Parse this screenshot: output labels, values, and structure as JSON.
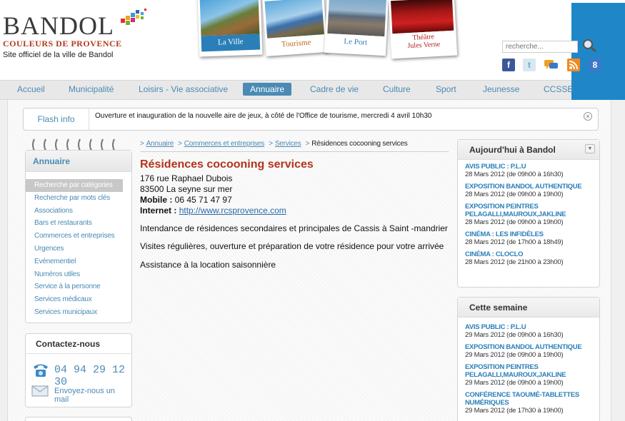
{
  "header": {
    "logo_title": "BANDOL",
    "logo_subtitle": "COULEURS DE PROVENCE",
    "site_name": "Site officiel de la ville de Bandol",
    "photos": [
      "La Ville",
      "Tourisme",
      "Le Port",
      "Théâtre\nJules Verne"
    ],
    "search_placeholder": "recherche...",
    "social": [
      "f",
      "t",
      "",
      "",
      "8"
    ]
  },
  "nav": {
    "items": [
      "Accueil",
      "Municipalité",
      "Loisirs - Vie associative",
      "Annuaire",
      "Cadre de vie",
      "Culture",
      "Sport",
      "Jeunesse",
      "CCSSB"
    ],
    "active": "Annuaire"
  },
  "flash": {
    "label": "Flash info",
    "text": "Ouverture et inauguration de la nouvelle aire de jeux, à côté de l'Office de tourisme, mercredi 4 avril 10h30",
    "close": "×"
  },
  "sidebar": {
    "title": "Annuaire",
    "items": [
      "Recherche par catégories",
      "Recherche par mots clés",
      "Associations",
      "Bars et restaurants",
      "Commerces et entreprises",
      "Urgences",
      "Evénementiel",
      "Numéros utiles",
      "Service à la personne",
      "Services médicaux",
      "Services municipaux"
    ],
    "active_index": 0
  },
  "contact": {
    "title": "Contactez-nous",
    "phone": "04 94 29 12 30",
    "mail_label": "Envoyez-nous un mail"
  },
  "breadcrumb": {
    "items": [
      "Annuaire",
      "Commerces et entreprises",
      "Services"
    ],
    "current": "Résidences cocooning services",
    "separator": ">"
  },
  "main": {
    "title": "Résidences cocooning services",
    "address_line1": "176 rue Raphael Dubois",
    "address_line2": "83500 La seyne sur mer",
    "mobile_label": "Mobile :",
    "mobile_value": " 06 45 71 47 97",
    "internet_label": "Internet :",
    "internet_value": "http://www.rcsprovence.com",
    "paragraphs": [
      "Intendance de résidences secondaires et principales de Cassis à Saint -mandrier",
      "Visites régulières, ouverture et préparation de votre résidence pour votre arrivée",
      "Assistance à la location saisonnière"
    ]
  },
  "today": {
    "title": "Aujourd'hui à Bandol",
    "events": [
      {
        "title": "AVIS PUBLIC : P.L.U",
        "date": "28 Mars 2012 (de 09h00 à 16h30)"
      },
      {
        "title": "EXPOSITION BANDOL AUTHENTIQUE",
        "date": "28 Mars 2012 (de 09h00 à 19h00)"
      },
      {
        "title": "EXPOSITION PEINTRES PELAGALLI,MAUROUX,JAKLINE",
        "date": "28 Mars 2012 (de 09h00 à 19h00)"
      },
      {
        "title": "CINÉMA : LES INFIDÈLES",
        "date": "28 Mars 2012 (de 17h00 à 18h49)"
      },
      {
        "title": "CINÉMA : CLOCLO",
        "date": "28 Mars 2012 (de 21h00 à 23h00)"
      }
    ]
  },
  "week": {
    "title": "Cette semaine",
    "events": [
      {
        "title": "AVIS PUBLIC : P.L.U",
        "date": "29 Mars 2012 (de 09h00 à 16h30)"
      },
      {
        "title": "EXPOSITION BANDOL AUTHENTIQUE",
        "date": "29 Mars 2012 (de 09h00 à 19h00)"
      },
      {
        "title": "EXPOSITION PEINTRES PELAGALLI,MAUROUX,JAKLINE",
        "date": "29 Mars 2012 (de 09h00 à 19h00)"
      },
      {
        "title": "CONFÉRENCE TAOUMÉ-TABLETTES NUMÉRIQUES",
        "date": "29 Mars 2012 (de 17h30 à 19h00)"
      }
    ]
  },
  "colors": {
    "accent": "#4a8ab4",
    "title_red": "#b3341a",
    "event_blue": "#2a7fb8",
    "corner_blue": "#1f87c8"
  }
}
